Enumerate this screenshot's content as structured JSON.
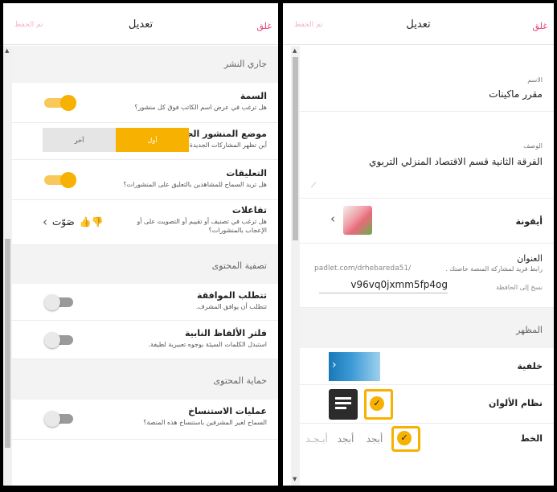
{
  "left": {
    "close": "غلق",
    "title": "تعديل",
    "saved": "تم الحفظ",
    "section_posting": "جاري النشر",
    "attribution": {
      "title": "السمة",
      "sub": "هل ترغب في عرض اسم الكاتب فوق كل منشور؟"
    },
    "new_post": {
      "title": "موضع المنشور الجديد",
      "sub": "أين تظهر المشاركات الجديدة؟",
      "first": "أول",
      "last": "آخر"
    },
    "comments": {
      "title": "التعليقات",
      "sub": "هل تريد السماح للمشاهدين بالتعليق على المنشورات؟"
    },
    "reactions": {
      "title": "تفاعلات",
      "sub": "هل ترغب في تصنيف أو تقييم أو التصويت على أو الإعجاب بالمنشورات؟",
      "value": "صَوّت"
    },
    "section_filter": "تصفية المحتوى",
    "approval": {
      "title": "تتطلب الموافقة",
      "sub": "تتطلب أن يوافق المشرف."
    },
    "profanity": {
      "title": "فلتر الألفاظ النابية",
      "sub": "استبدل الكلمات السيئة بوجوه تعبيرية لطيفة."
    },
    "section_protect": "حماية المحتوى",
    "copying": {
      "title": "عمليات الاستنساخ",
      "sub": "السماح لغير المشرفين باستنساخ هذه المنصة؟"
    }
  },
  "right": {
    "close": "غلق",
    "title": "تعديل",
    "saved": "تم الحفظ",
    "name_label": "الاسم",
    "name_value": "مقرر ماكينات",
    "desc_label": "الوصف",
    "desc_value": "الفرقة الثانية قسم الاقتصاد المنزلي التربوي",
    "icon_label": "أيقونة",
    "address_label": "العنوان",
    "address_sub": "رابط فريد لمشاركة المنصة خاصتك .",
    "url_prefix": "padlet.com/drhebareda51/",
    "url_slug": "v96vq0jxmm5fp4og",
    "copy_label": "نسخ إلى الحافظة",
    "section_appearance": "المظهر",
    "wallpaper_label": "خلفية",
    "color_label": "نظام الألوان",
    "font_label": "الخط",
    "font_samples": [
      "أبجد",
      "أبجد",
      "أبجد",
      "أبـجـد"
    ]
  },
  "colors": {
    "accent": "#f7b100",
    "close": "#e6417b"
  }
}
